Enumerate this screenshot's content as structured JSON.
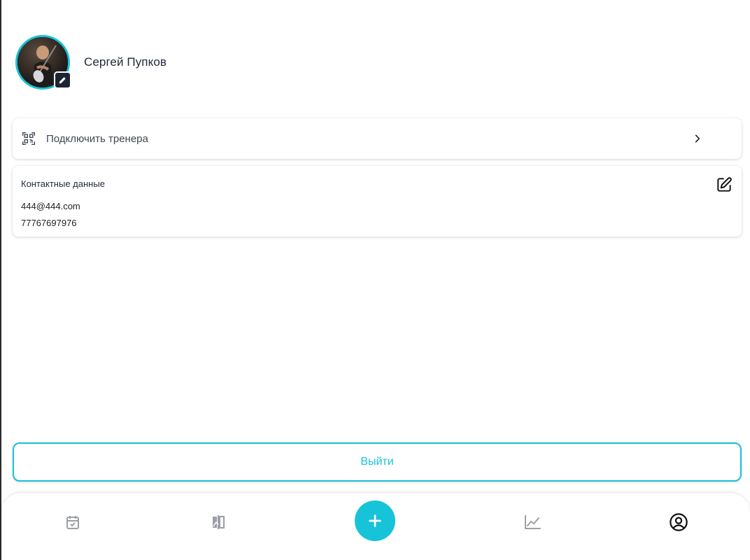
{
  "profile": {
    "name": "Сергей Пупков",
    "avatar_alt": "avatar"
  },
  "coach_connect": {
    "label": "Подключить тренера",
    "icon": "qr-code-icon"
  },
  "contacts": {
    "title": "Контактные данные",
    "email": "444@444.com",
    "phone": "77767697976",
    "edit_icon": "edit-icon"
  },
  "logout": {
    "label": "Выйти"
  },
  "tabbar": {
    "items": [
      {
        "icon": "calendar-check-icon",
        "active": false
      },
      {
        "icon": "compare-icon",
        "active": false
      },
      {
        "icon": "add-icon",
        "active": false
      },
      {
        "icon": "chart-icon",
        "active": false
      },
      {
        "icon": "profile-icon",
        "active": true
      }
    ]
  },
  "colors": {
    "accent": "#17c3d8",
    "text": "#1f2937",
    "inactive_icon": "#9aa0a6",
    "active_icon": "#111111"
  }
}
